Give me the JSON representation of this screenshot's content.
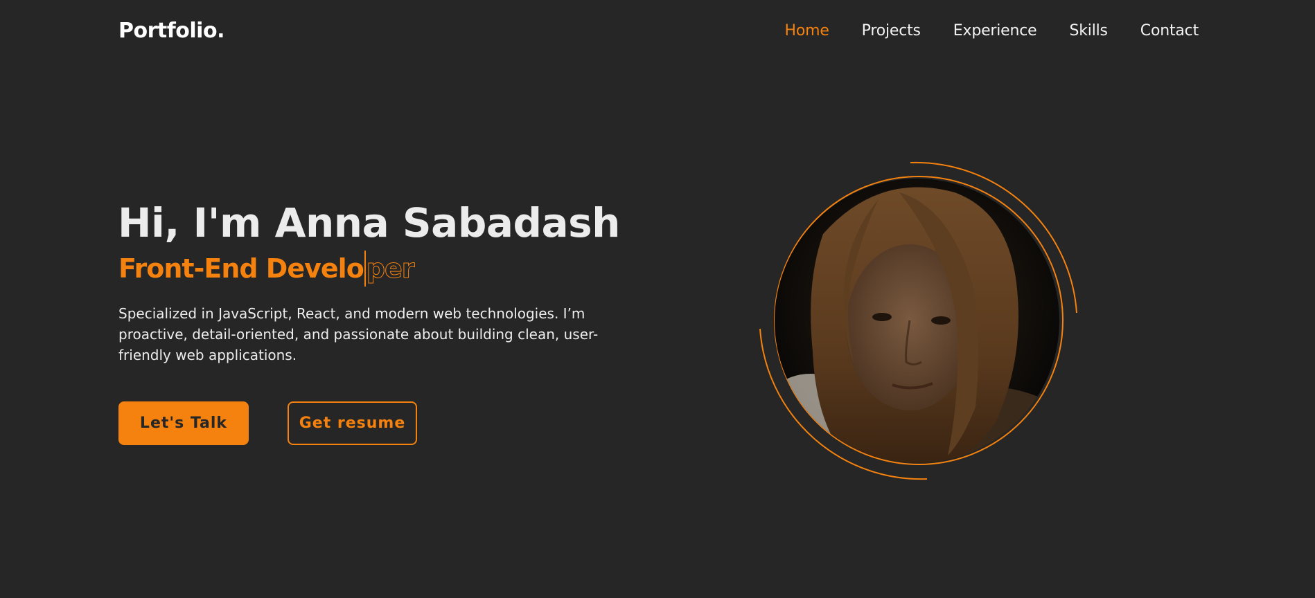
{
  "header": {
    "logo": "Portfolio.",
    "nav": [
      {
        "label": "Home",
        "active": true
      },
      {
        "label": "Projects",
        "active": false
      },
      {
        "label": "Experience",
        "active": false
      },
      {
        "label": "Skills",
        "active": false
      },
      {
        "label": "Contact",
        "active": false
      }
    ]
  },
  "hero": {
    "title": "Hi, I'm Anna Sabadash",
    "role_typed": "Front-End Develo",
    "role_remaining": "per",
    "intro": "Specialized in JavaScript, React, and modern web technologies. I’m proactive, detail-oriented, and passionate about building clean, user-friendly web applications.",
    "primary_button": "Let's Talk",
    "secondary_button": "Get resume"
  },
  "portrait": {
    "icon": "portrait-photo"
  },
  "colors": {
    "background": "#262626",
    "accent": "#f5820f",
    "text": "#f2f2f2"
  }
}
